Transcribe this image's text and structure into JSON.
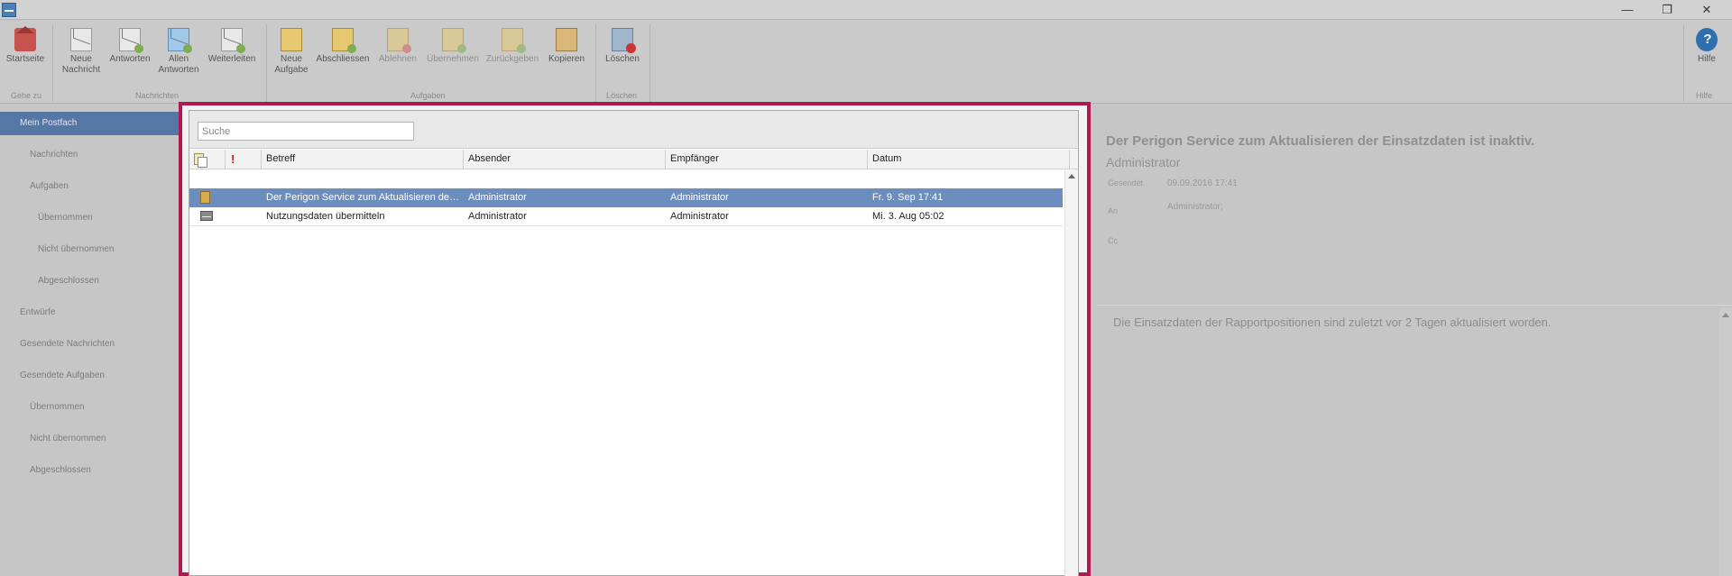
{
  "window": {
    "min_symbol": "—",
    "max_symbol": "❐",
    "close_symbol": "✕"
  },
  "ribbon": {
    "buttons": {
      "startseite": "Startseite",
      "neue_nachricht_1": "Neue",
      "neue_nachricht_2": "Nachricht",
      "antworten": "Antworten",
      "allen_antworten_1": "Allen",
      "allen_antworten_2": "Antworten",
      "weiterleiten": "Weiterleiten",
      "neue_aufgabe_1": "Neue",
      "neue_aufgabe_2": "Aufgabe",
      "abschliessen": "Abschliessen",
      "ablehnen": "Ablehnen",
      "uebernehmen": "Übernehmen",
      "zurueckgeben": "Zurückgeben",
      "kopieren": "Kopieren",
      "loeschen": "Löschen",
      "hilfe": "Hilfe"
    },
    "groups": {
      "gehe_zu": "Gehe zu",
      "nachrichten": "Nachrichten",
      "aufgaben": "Aufgaben",
      "loeschen": "Löschen",
      "hilfe": "Hilfe"
    }
  },
  "sidebar": {
    "items": [
      {
        "label": "Mein Postfach"
      },
      {
        "label": "Nachrichten"
      },
      {
        "label": "Aufgaben"
      },
      {
        "label": "Übernommen"
      },
      {
        "label": "Nicht übernommen"
      },
      {
        "label": "Abgeschlossen"
      },
      {
        "label": "Entwürfe"
      },
      {
        "label": "Gesendete Nachrichten"
      },
      {
        "label": "Gesendete Aufgaben"
      },
      {
        "label": "Übernommen"
      },
      {
        "label": "Nicht übernommen"
      },
      {
        "label": "Abgeschlossen"
      }
    ]
  },
  "list": {
    "search_placeholder": "Suche",
    "columns": {
      "importance": "!",
      "subject": "Betreff",
      "sender": "Absender",
      "recipient": "Empfänger",
      "date": "Datum"
    },
    "rows": [
      {
        "type": "task",
        "subject": "Der Perigon Service zum Aktualisieren der...",
        "sender": "Administrator",
        "recipient": "Administrator",
        "date": "Fr. 9. Sep 17:41"
      },
      {
        "type": "mail",
        "subject": "Nutzungsdaten übermitteln",
        "sender": "Administrator",
        "recipient": "Administrator",
        "date": "Mi. 3. Aug 05:02"
      }
    ]
  },
  "reading_pane": {
    "subject": "Der Perigon Service zum Aktualisieren der Einsatzdaten ist inaktiv.",
    "sender": "Administrator",
    "sent_label": "Gesendet",
    "sent_value": "09.09.2016 17:41",
    "to_label": "An",
    "to_value": "Administrator;",
    "cc_label": "Cc",
    "body": "Die Einsatzdaten der Rapportpositionen sind zuletzt vor 2 Tagen aktualisiert worden."
  },
  "colors": {
    "modal_border": "#b2184f",
    "selected_row": "#6c8ebf",
    "sidebar_active": "#5676a6"
  }
}
